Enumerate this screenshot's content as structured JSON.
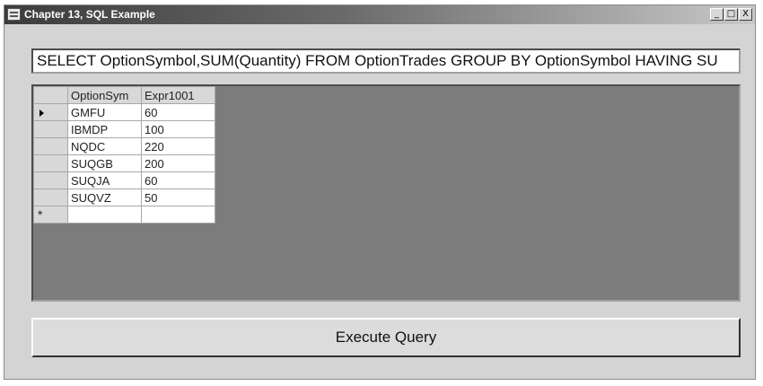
{
  "window": {
    "title": "Chapter 13, SQL Example",
    "buttons": {
      "minimize": "_",
      "maximize": "□",
      "close": "X"
    }
  },
  "query": {
    "value": "SELECT OptionSymbol,SUM(Quantity) FROM OptionTrades GROUP BY OptionSymbol HAVING SU"
  },
  "grid": {
    "columns": [
      "OptionSym",
      "Expr1001"
    ],
    "rows": [
      [
        "GMFU",
        "60"
      ],
      [
        "IBMDP",
        "100"
      ],
      [
        "NQDC",
        "220"
      ],
      [
        "SUQGB",
        "200"
      ],
      [
        "SUQJA",
        "60"
      ],
      [
        "SUQVZ",
        "50"
      ]
    ],
    "new_row_marker": "*"
  },
  "execute_button": {
    "label": "Execute Query"
  }
}
